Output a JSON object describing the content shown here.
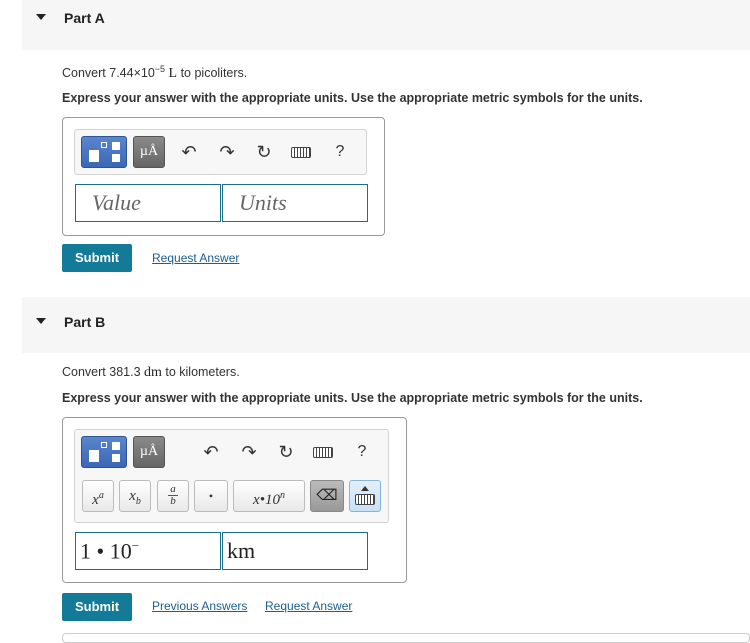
{
  "partA": {
    "title": "Part A",
    "question_prefix": "Convert 7.44×10",
    "question_exp": "−5",
    "question_unit": "L",
    "question_suffix": " to picoliters.",
    "instruction": "Express your answer with the appropriate units. Use the appropriate metric symbols for the units.",
    "units_button": "µÅ",
    "help": "?",
    "value_placeholder": "Value",
    "units_placeholder": "Units",
    "submit": "Submit",
    "request_answer": "Request Answer"
  },
  "partB": {
    "title": "Part B",
    "question_prefix": "Convert 381.3 ",
    "question_unit": "dm",
    "question_suffix": " to kilometers.",
    "instruction": "Express your answer with the appropriate units. Use the appropriate metric symbols for the units.",
    "units_button": "µÅ",
    "help": "?",
    "sub_buttons": {
      "power": "x",
      "power_sup": "a",
      "subscript": "x",
      "subscript_sub": "b",
      "fraction_num": "a",
      "fraction_den": "b",
      "dot": "•",
      "scinot": "x•10",
      "scinot_sup": "n",
      "backspace": "⌫"
    },
    "value_field": "1 • 10",
    "value_sup": "−",
    "units_field": "km",
    "submit": "Submit",
    "previous_answers": "Previous Answers",
    "request_answer": "Request Answer"
  },
  "colors": {
    "submit_bg": "#137b97",
    "link": "#1a5f8f",
    "field_border": "#1c6f89",
    "header_bg": "#f6f6f6"
  }
}
